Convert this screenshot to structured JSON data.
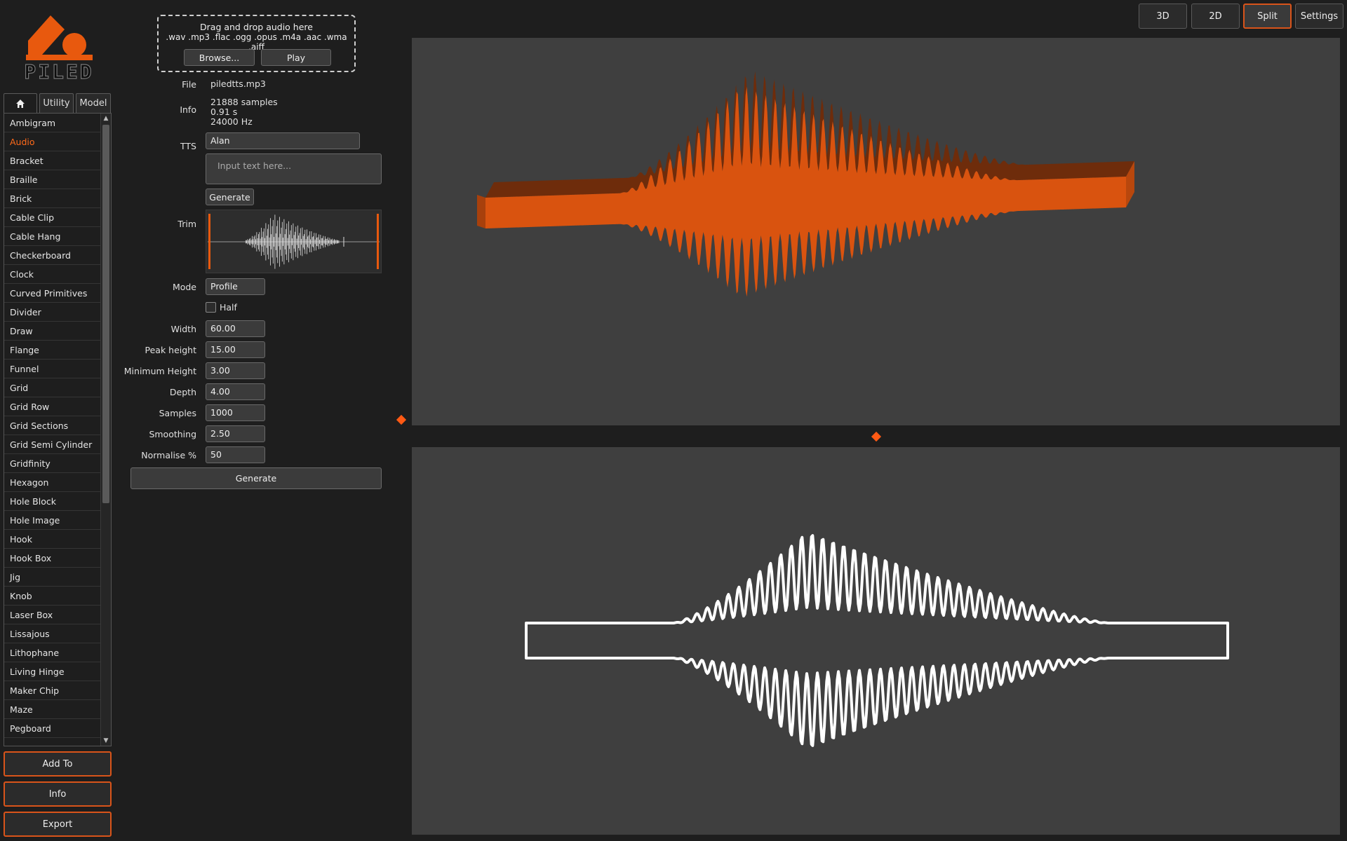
{
  "logo": {
    "text": "PILED"
  },
  "tabs": [
    {
      "icon": "home-icon",
      "label": ""
    },
    {
      "label": "Utility"
    },
    {
      "label": "Model"
    }
  ],
  "sidebar": {
    "selected": "Audio",
    "items": [
      "Ambigram",
      "Audio",
      "Bracket",
      "Braille",
      "Brick",
      "Cable Clip",
      "Cable Hang",
      "Checkerboard",
      "Clock",
      "Curved Primitives",
      "Divider",
      "Draw",
      "Flange",
      "Funnel",
      "Grid",
      "Grid Row",
      "Grid Sections",
      "Grid Semi Cylinder",
      "Gridfinity",
      "Hexagon",
      "Hole Block",
      "Hole Image",
      "Hook",
      "Hook Box",
      "Jig",
      "Knob",
      "Laser Box",
      "Lissajous",
      "Lithophane",
      "Living Hinge",
      "Maker Chip",
      "Maze",
      "Pegboard"
    ]
  },
  "side_buttons": {
    "add_to": "Add To",
    "info": "Info",
    "export": "Export"
  },
  "dropzone": {
    "title": "Drag and drop audio here",
    "formats": ".wav .mp3 .flac .ogg .opus .m4a .aac .wma .aiff",
    "browse": "Browse...",
    "play": "Play"
  },
  "file": {
    "label": "File",
    "value": "piledtts.mp3"
  },
  "info": {
    "label": "Info",
    "samples": "21888 samples",
    "duration": "0.91 s",
    "rate": "24000 Hz"
  },
  "tts": {
    "label": "TTS",
    "voice": "Alan",
    "placeholder": "Input text here...",
    "generate": "Generate"
  },
  "trim": {
    "label": "Trim"
  },
  "mode": {
    "label": "Mode",
    "value": "Profile"
  },
  "half": {
    "label": "Half",
    "checked": false
  },
  "params": [
    {
      "key": "width",
      "label": "Width",
      "value": "60.00"
    },
    {
      "key": "peak-height",
      "label": "Peak height",
      "value": "15.00"
    },
    {
      "key": "minimum-height",
      "label": "Minimum Height",
      "value": "3.00"
    },
    {
      "key": "depth",
      "label": "Depth",
      "value": "4.00"
    },
    {
      "key": "samples",
      "label": "Samples",
      "value": "1000"
    },
    {
      "key": "smoothing",
      "label": "Smoothing",
      "value": "2.50"
    },
    {
      "key": "normalise",
      "label": "Normalise %",
      "value": "50"
    }
  ],
  "generate": "Generate",
  "view_modes": {
    "v3d": "3D",
    "v2d": "2D",
    "split": "Split",
    "settings": "Settings",
    "active": "Split"
  },
  "colors": {
    "accent": "#d9541a",
    "model": "#d9530f",
    "model_top": "#7a2f0a",
    "viewport": "#3f3f3f",
    "profile": "#ffffff"
  }
}
